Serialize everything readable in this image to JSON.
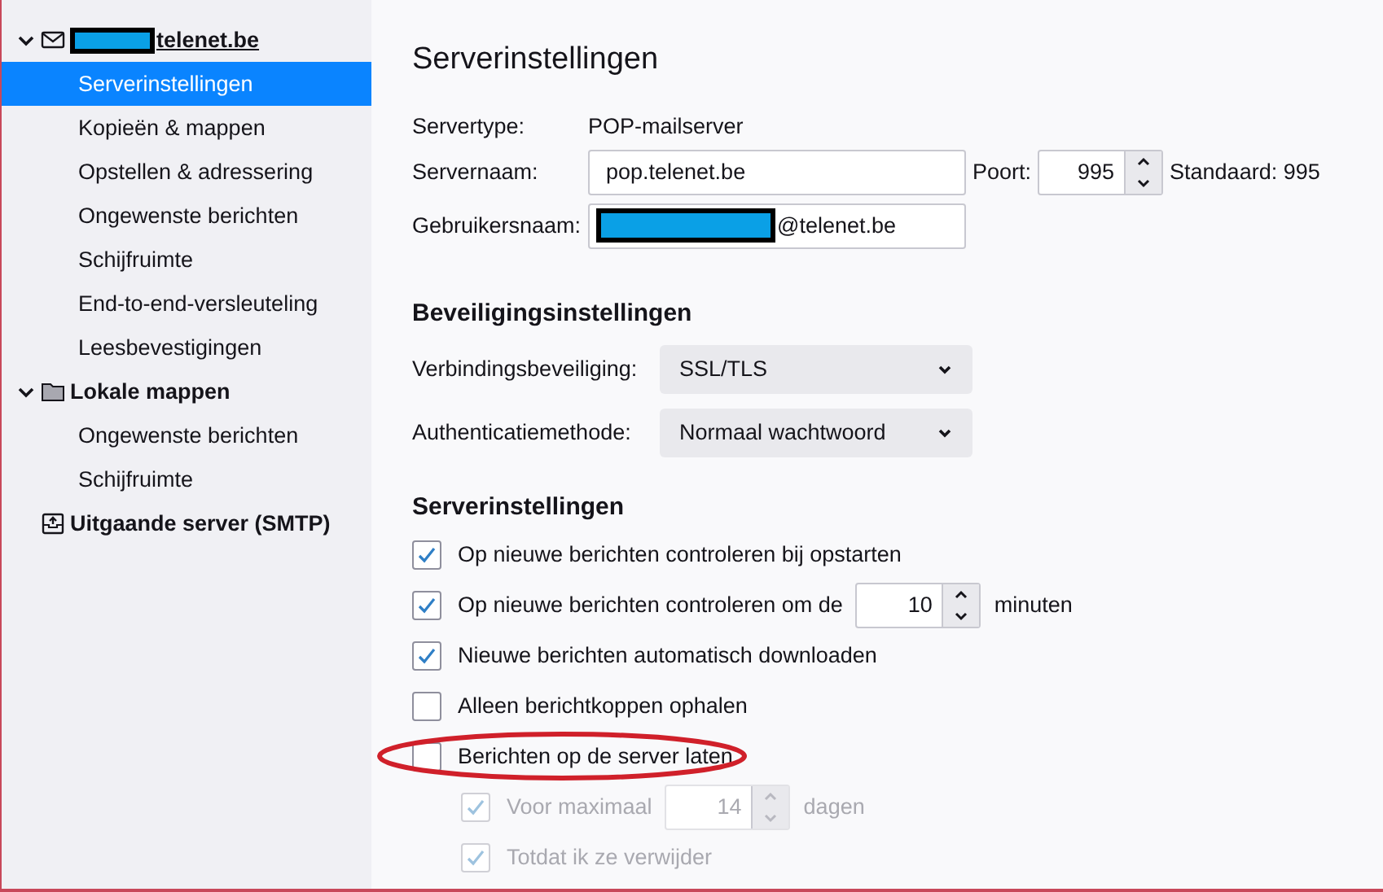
{
  "sidebar": {
    "accounts": [
      {
        "kind": "mail",
        "name": "telenet.be",
        "redacted": true,
        "expanded": true,
        "children": [
          {
            "label": "Serverinstellingen",
            "selected": true
          },
          {
            "label": "Kopieën & mappen",
            "selected": false
          },
          {
            "label": "Opstellen & adressering",
            "selected": false
          },
          {
            "label": "Ongewenste berichten",
            "selected": false
          },
          {
            "label": "Schijfruimte",
            "selected": false
          },
          {
            "label": "End-to-end-versleuteling",
            "selected": false
          },
          {
            "label": "Leesbevestigingen",
            "selected": false
          }
        ]
      },
      {
        "kind": "folder",
        "name": "Lokale mappen",
        "redacted": false,
        "expanded": true,
        "children": [
          {
            "label": "Ongewenste berichten",
            "selected": false
          },
          {
            "label": "Schijfruimte",
            "selected": false
          }
        ]
      },
      {
        "kind": "outbox",
        "name": "Uitgaande server (SMTP)",
        "redacted": false
      }
    ]
  },
  "main": {
    "title": "Serverinstellingen",
    "server": {
      "type_label": "Servertype:",
      "type_value": "POP-mailserver",
      "name_label": "Servernaam:",
      "name_value": "pop.telenet.be",
      "port_label": "Poort:",
      "port_value": "995",
      "port_default": "Standaard: 995",
      "user_label": "Gebruikersnaam:",
      "user_value": "@telenet.be",
      "user_redacted": true
    },
    "security": {
      "heading": "Beveiligingsinstellingen",
      "fields": [
        {
          "label": "Verbindingsbeveiliging:",
          "value": "SSL/TLS"
        },
        {
          "label": "Authenticatiemethode:",
          "value": "Normaal wachtwoord"
        }
      ]
    },
    "settings": {
      "heading": "Serverinstellingen",
      "options": [
        {
          "label": "Op nieuwe berichten controleren bij opstarten",
          "checked": true,
          "disabled": false,
          "circled": false
        },
        {
          "label": "Op nieuwe berichten controleren om de",
          "checked": true,
          "disabled": false,
          "circled": false,
          "spinner": "10",
          "suffix": "minuten"
        },
        {
          "label": "Nieuwe berichten automatisch downloaden",
          "checked": true,
          "disabled": false,
          "circled": false
        },
        {
          "label": "Alleen berichtkoppen ophalen",
          "checked": false,
          "disabled": false,
          "circled": false
        },
        {
          "label": "Berichten op de server laten",
          "checked": false,
          "disabled": false,
          "circled": true,
          "children": [
            {
              "label": "Voor maximaal",
              "checked": true,
              "disabled": true,
              "circled": false,
              "spinner": "14",
              "suffix": "dagen"
            },
            {
              "label": "Totdat ik ze verwijder",
              "checked": true,
              "disabled": true,
              "circled": false
            }
          ]
        }
      ]
    }
  }
}
